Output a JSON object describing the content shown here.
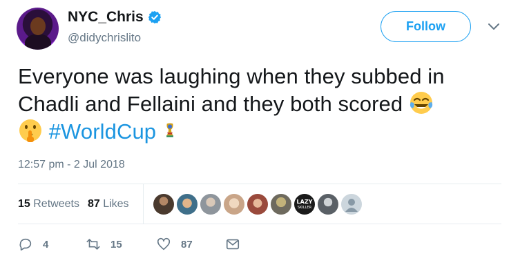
{
  "author": {
    "display_name": "NYC_Chris",
    "handle": "@didychrislito",
    "verified": true
  },
  "follow_label": "Follow",
  "tweet": {
    "text_line1": "Everyone was laughing when they subbed in",
    "text_line2": "Chadli and Fellaini and they both scored",
    "hashtag": "#WorldCup",
    "timestamp": "12:57 pm - 2 Jul 2018"
  },
  "stats": {
    "retweets_count": "15",
    "retweets_label": "Retweets",
    "likes_count": "87",
    "likes_label": "Likes"
  },
  "likers": [
    {
      "color": "#4a3a2e"
    },
    {
      "color": "#3f6f8a"
    },
    {
      "color": "#8e959c"
    },
    {
      "color": "#c9a588"
    },
    {
      "color": "#9a4a3c"
    },
    {
      "color": "#6e6a5e"
    },
    {
      "color": "#1a1a1a",
      "label": "LAZY SKILLER"
    },
    {
      "color": "#5a6066"
    },
    {
      "color": "#ccd6dd"
    }
  ],
  "actions": {
    "reply_count": "4",
    "retweet_count": "15",
    "like_count": "87"
  },
  "colors": {
    "accent": "#1da1f2",
    "hashtag": "#1b95e0",
    "secondary_text": "#657786",
    "divider": "#e6ecf0"
  },
  "icons": [
    "verified-badge-icon",
    "chevron-down-icon",
    "tears-of-joy-emoji",
    "shushing-face-emoji",
    "world-cup-trophy-emoji",
    "reply-icon",
    "retweet-icon",
    "heart-icon",
    "envelope-icon"
  ]
}
